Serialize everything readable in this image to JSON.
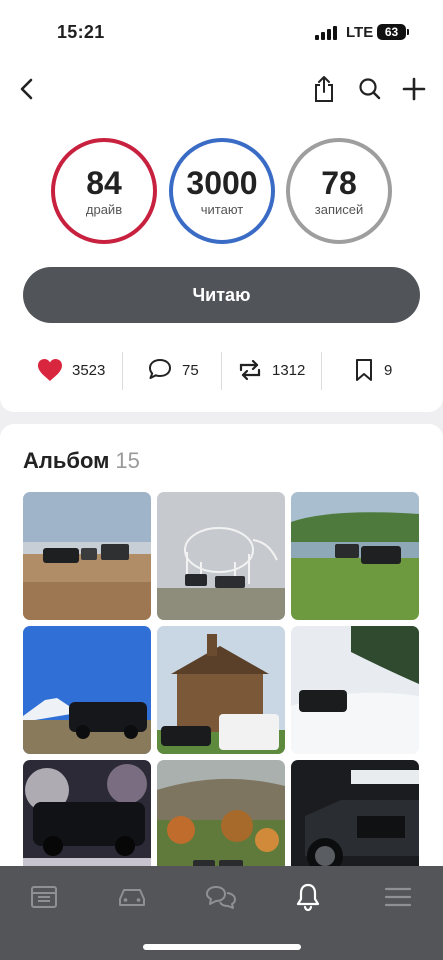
{
  "status_bar": {
    "time": "15:21",
    "network": "LTE",
    "battery": "63"
  },
  "nav": {
    "back_icon": "chevron-left-icon",
    "share_icon": "share-icon",
    "search_icon": "search-icon",
    "add_icon": "plus-icon"
  },
  "stats": [
    {
      "value": "84",
      "label": "драйв",
      "color": "#c8213f"
    },
    {
      "value": "3000",
      "label": "читают",
      "color": "#3a6cc6"
    },
    {
      "value": "78",
      "label": "записей",
      "color": "#9e9e9e"
    }
  ],
  "read_button": "Читаю",
  "actions": {
    "likes": "3523",
    "comments": "75",
    "reposts": "1312",
    "bookmarks": "9",
    "like_color": "#d9263f"
  },
  "album": {
    "title": "Альбом",
    "count": "15"
  },
  "tabs": [
    "feed-icon",
    "garage-icon",
    "messages-icon",
    "notifications-icon",
    "menu-icon"
  ]
}
